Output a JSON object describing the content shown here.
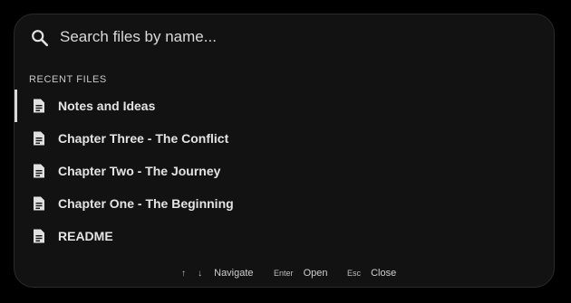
{
  "search": {
    "placeholder": "Search files by name...",
    "icon": "search-icon"
  },
  "recent": {
    "section_label": "RECENT FILES",
    "active_index": 0,
    "items": [
      {
        "name": "Notes and Ideas",
        "icon": "document-icon"
      },
      {
        "name": "Chapter Three - The Conflict",
        "icon": "document-icon"
      },
      {
        "name": "Chapter Two - The Journey",
        "icon": "document-icon"
      },
      {
        "name": "Chapter One - The Beginning",
        "icon": "document-icon"
      },
      {
        "name": "README",
        "icon": "document-icon"
      }
    ]
  },
  "footer": {
    "navigate": {
      "key_up": "↑",
      "key_down": "↓",
      "label": "Navigate"
    },
    "open": {
      "key": "Enter",
      "label": "Open"
    },
    "close": {
      "key": "Esc",
      "label": "Close"
    }
  },
  "colors": {
    "background": "#000000",
    "panel": "#121212",
    "text": "#e4e4e4",
    "active_indicator": "#d8d8d8"
  }
}
